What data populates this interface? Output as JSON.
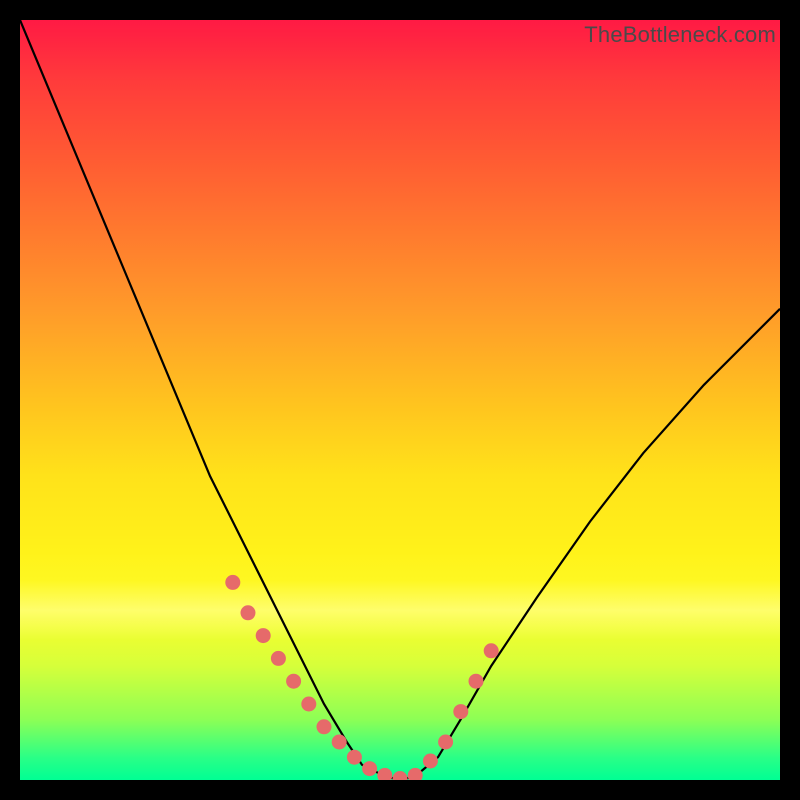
{
  "watermark": "TheBottleneck.com",
  "colors": {
    "marker": "#e66a6a",
    "curve": "#000000",
    "frame_bg": "#000000",
    "gradient_stops": [
      "#ff1a44",
      "#ff3b3b",
      "#ff5a33",
      "#ff7a2e",
      "#ff9a2a",
      "#ffc21f",
      "#ffe21a",
      "#fff21a",
      "#fdfd2a",
      "#d6ff3a",
      "#8dff55",
      "#2bff86",
      "#00ff94"
    ]
  },
  "chart_data": {
    "type": "line",
    "title": "",
    "xlabel": "",
    "ylabel": "",
    "xlim": [
      0,
      100
    ],
    "ylim": [
      0,
      100
    ],
    "grid": false,
    "legend": false,
    "series": [
      {
        "name": "bottleneck-curve",
        "x": [
          0,
          5,
          10,
          15,
          20,
          25,
          30,
          35,
          40,
          43,
          45,
          48,
          50,
          52,
          55,
          58,
          62,
          68,
          75,
          82,
          90,
          100
        ],
        "y": [
          100,
          88,
          76,
          64,
          52,
          40,
          30,
          20,
          10,
          5,
          2,
          0.5,
          0,
          0.5,
          3,
          8,
          15,
          24,
          34,
          43,
          52,
          62
        ]
      }
    ],
    "markers": {
      "name": "highlighted-points",
      "x": [
        28,
        30,
        32,
        34,
        36,
        38,
        40,
        42,
        44,
        46,
        48,
        50,
        52,
        54,
        56,
        58,
        60,
        62
      ],
      "y": [
        26,
        22,
        19,
        16,
        13,
        10,
        7,
        5,
        3,
        1.5,
        0.6,
        0.2,
        0.6,
        2.5,
        5,
        9,
        13,
        17
      ]
    }
  }
}
